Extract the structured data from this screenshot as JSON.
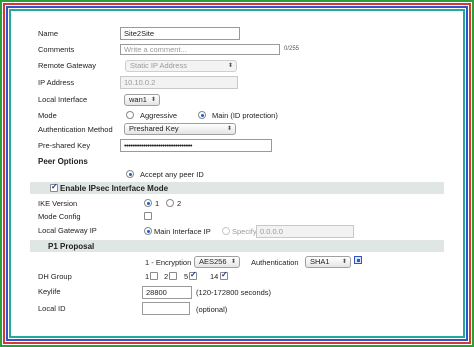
{
  "name": {
    "label": "Name",
    "value": "Site2Site"
  },
  "comments": {
    "label": "Comments",
    "placeholder": "Write a comment...",
    "counter": "0/255"
  },
  "remote_gateway": {
    "label": "Remote Gateway",
    "value": "Static IP Address"
  },
  "ip_address": {
    "label": "IP Address",
    "value": "10.10.0.2"
  },
  "local_interface": {
    "label": "Local Interface",
    "value": "wan1"
  },
  "mode": {
    "label": "Mode",
    "options": [
      "Aggressive",
      "Main (ID protection)"
    ],
    "selected": "Main (ID protection)"
  },
  "auth_method": {
    "label": "Authentication Method",
    "value": "Preshared Key"
  },
  "psk": {
    "label": "Pre-shared Key",
    "value": "••••••••••••••••••••••••••••••••"
  },
  "peer_options": {
    "heading": "Peer Options",
    "option": "Accept any peer ID"
  },
  "ipsec_section": {
    "title": "Enable IPsec Interface Mode",
    "checked": true
  },
  "ike_version": {
    "label": "IKE Version",
    "options": [
      "1",
      "2"
    ],
    "selected": "1"
  },
  "mode_config": {
    "label": "Mode Config",
    "checked": false
  },
  "local_gateway": {
    "label": "Local Gateway IP",
    "main_option": "Main Interface IP",
    "specify_option": "Specify",
    "specify_value": "0.0.0.0"
  },
  "p1_proposal": {
    "title": "P1 Proposal",
    "encryption_label": "1 - Encryption",
    "encryption_value": "AES256",
    "auth_label": "Authentication",
    "auth_value": "SHA1"
  },
  "dh_group": {
    "label": "DH Group",
    "options": [
      "1",
      "2",
      "5",
      "14"
    ],
    "checked": [
      "5",
      "14"
    ]
  },
  "keylife": {
    "label": "Keylife",
    "value": "28800",
    "hint": "(120-172800 seconds)"
  },
  "local_id": {
    "label": "Local ID",
    "value": "",
    "hint": "(optional)"
  }
}
